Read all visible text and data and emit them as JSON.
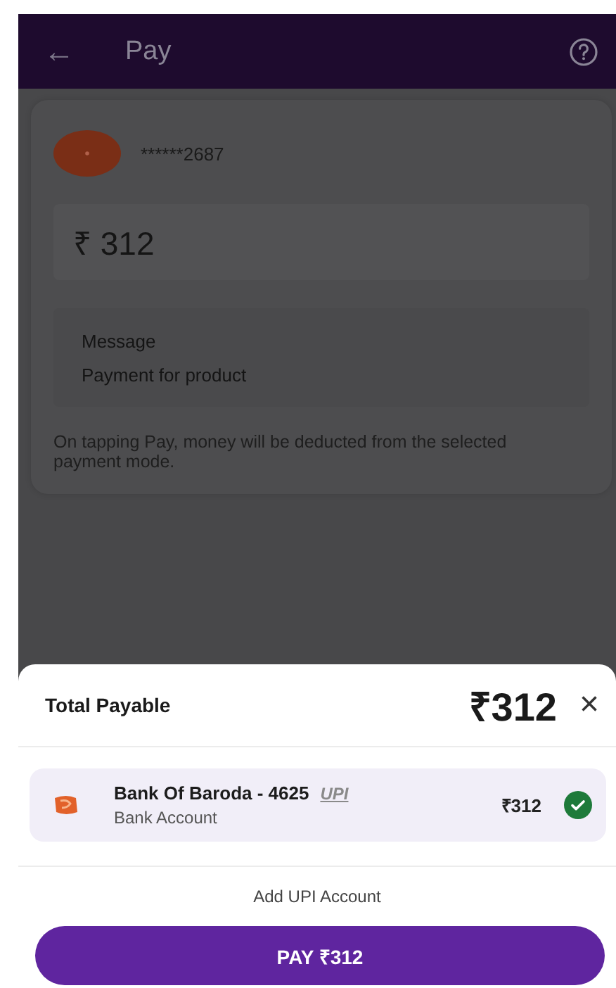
{
  "header": {
    "back": "←",
    "title": "Pay"
  },
  "payee": {
    "id": "******2687"
  },
  "amount": {
    "value": "₹ 312"
  },
  "message": {
    "label": "Message",
    "value": "Payment for product"
  },
  "note": "On tapping Pay, money will be deducted from the selected payment mode.",
  "sheet": {
    "title": "Total Payable",
    "total": "₹312",
    "close": "×",
    "accounts": [
      {
        "name": "Bank Of Baroda - 4625",
        "badge": "UPI",
        "type": "Bank Account",
        "amount": "₹312",
        "selected": true
      }
    ],
    "add_link": "Add UPI Account",
    "pay_button": "PAY ₹312"
  }
}
